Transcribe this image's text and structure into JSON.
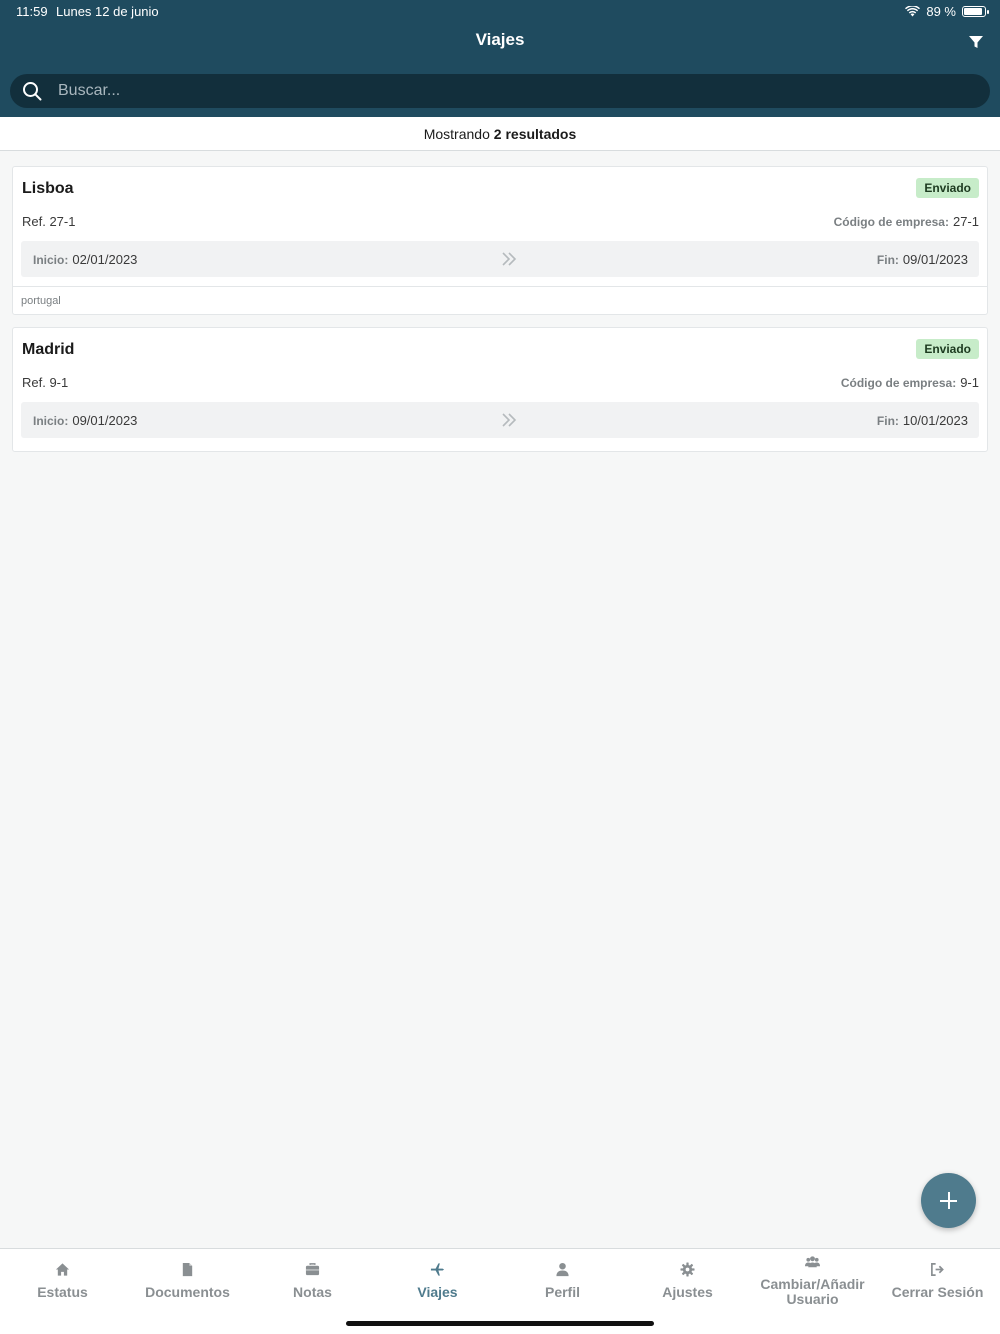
{
  "status_bar": {
    "time": "11:59",
    "date": "Lunes 12 de junio",
    "battery": "89 %",
    "battery_level": 0.89
  },
  "header": {
    "title": "Viajes",
    "filter_icon": "filter-icon"
  },
  "search": {
    "placeholder": "Buscar...",
    "value": ""
  },
  "results": {
    "prefix": "Mostrando",
    "count": "2",
    "suffix": "resultados"
  },
  "trips": [
    {
      "name": "Lisboa",
      "status": "Enviado",
      "ref": "Ref. 27-1",
      "company_label": "Código de empresa:",
      "company_code": "27-1",
      "start_label": "Inicio:",
      "start_date": "02/01/2023",
      "end_label": "Fin:",
      "end_date": "09/01/2023",
      "note": "portugal"
    },
    {
      "name": "Madrid",
      "status": "Enviado",
      "ref": "Ref. 9-1",
      "company_label": "Código de empresa:",
      "company_code": "9-1",
      "start_label": "Inicio:",
      "start_date": "09/01/2023",
      "end_label": "Fin:",
      "end_date": "10/01/2023",
      "note": ""
    }
  ],
  "tabs": [
    {
      "label": "Estatus",
      "icon": "home-icon",
      "active": false
    },
    {
      "label": "Documentos",
      "icon": "document-icon",
      "active": false
    },
    {
      "label": "Notas",
      "icon": "briefcase-icon",
      "active": false
    },
    {
      "label": "Viajes",
      "icon": "plane-icon",
      "active": true
    },
    {
      "label": "Perfil",
      "icon": "user-icon",
      "active": false
    },
    {
      "label": "Ajustes",
      "icon": "gear-icon",
      "active": false
    },
    {
      "label": "Cambiar/Añadir Usuario",
      "icon": "users-icon",
      "active": false
    },
    {
      "label": "Cerrar Sesión",
      "icon": "logout-icon",
      "active": false
    }
  ],
  "colors": {
    "header": "#1f4b5f",
    "search": "#122f3c",
    "accent": "#4f7b8d",
    "badge": "#c7ecc9"
  }
}
